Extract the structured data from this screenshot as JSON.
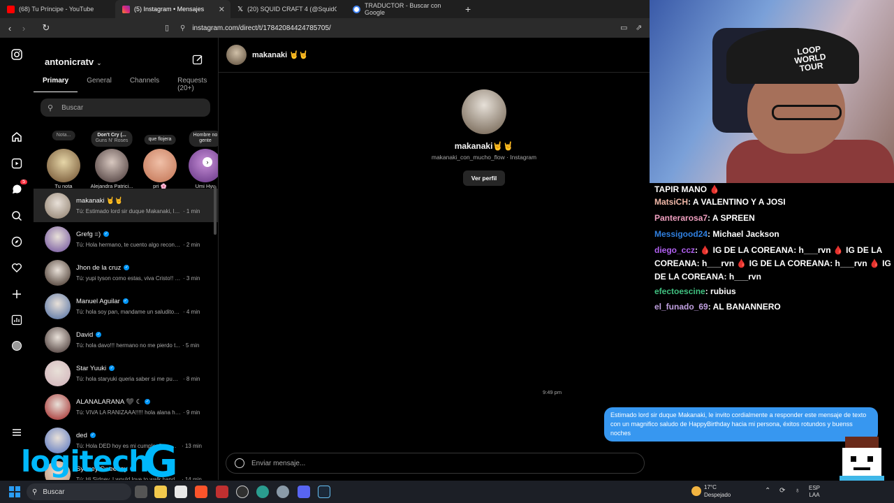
{
  "browser": {
    "tabs": [
      {
        "title": "(68) Tu Príncipe - YouTube",
        "color": "#ff0000"
      },
      {
        "title": "(5) Instagram • Mensajes",
        "color": "#e1306c",
        "active": true
      },
      {
        "title": "(20) SQUID CRAFT 4 (@SquidCraftGa",
        "color": "#000000"
      },
      {
        "title": "TRADUCTOR - Buscar con Google",
        "color": "#4285f4"
      }
    ],
    "new_tab": "+",
    "url": "instagram.com/direct/t/17842084424785705/"
  },
  "inbox": {
    "account": "antonicratv",
    "tabs": [
      "Primary",
      "General",
      "Channels",
      "Requests (20+)"
    ],
    "search_placeholder": "Buscar",
    "notes": [
      {
        "bubble": "Nota...",
        "name": "Tu nota",
        "color": "#d8c8a0"
      },
      {
        "bubble": "Don't Cry (...",
        "bubble2": "Guns N' Roses",
        "name": "Alejandra Patrici...",
        "color": "#c0b0a8"
      },
      {
        "bubble": "que flojera",
        "name": "pri 🌸",
        "color": "#e7a48c"
      },
      {
        "bubble": "Hombre no",
        "bubble2": "gente",
        "name": "Umi Hyu",
        "color": "#a070c0"
      }
    ],
    "threads": [
      {
        "name": "makanaki 🤘🤘",
        "preview": "Tú: Estimado lord sir duque Makanaki, le ...",
        "time": "· 1 min",
        "verified": false,
        "color": "#8a7a68"
      },
      {
        "name": "Grefg =)",
        "preview": "Tú: Hola hermano, te cuento algo recontr...",
        "time": "· 2 min",
        "verified": true,
        "color": "#6a4a9a"
      },
      {
        "name": "Jhon de la cruz",
        "preview": "Tú: yupi tyson como estas, viva Cristo!! h...",
        "time": "· 3 min",
        "verified": true,
        "color": "#3a2a20"
      },
      {
        "name": "Manuel Aguilar",
        "preview": "Tú: hola soy pan, mandame un saludito p...",
        "time": "· 4 min",
        "verified": true,
        "color": "#4a6aa0"
      },
      {
        "name": "David",
        "preview": "Tú: hola davo!!! hermano no me pierdo t...",
        "time": "· 5 min",
        "verified": true,
        "color": "#3a2a28"
      },
      {
        "name": "Star Yuuki",
        "preview": "Tú: hola staryuki queria saber si me pued...",
        "time": "· 8 min",
        "verified": true,
        "color": "#d0b0b8"
      },
      {
        "name": "ALANALARANA 🖤 ☾",
        "preview": "Tú: VIVA LA RANIZAAA!!!!! hola alana hoy...",
        "time": "· 9 min",
        "verified": true,
        "color": "#a02020"
      },
      {
        "name": "ded",
        "preview": "Tú: Hola DED hoy es mi cumpleaños, m...",
        "time": "· 13 min",
        "verified": true,
        "color": "#5070c0"
      },
      {
        "name": "Sydney Sweeney",
        "preview": "Tú: Hi Sidney, I would love to walk hand...",
        "time": "· 14 min",
        "verified": true,
        "color": "#c09070"
      }
    ]
  },
  "chat": {
    "header_name": "makanaki 🤘🤘",
    "profile_name": "makanaki🤘🤘",
    "profile_sub": "makanaki_con_mucho_flow · Instagram",
    "view_profile": "Ver perfil",
    "timestamp": "9:49 pm",
    "message": "Estimado lord sir duque Makanaki, le invito cordialmente a responder este mensaje de texto con un magnifico saludo de HappyBirthday hacia mi persona, éxitos rotundos y buenss noches",
    "composer_placeholder": "Enviar mensaje..."
  },
  "webcam": {
    "cap_text": "LOOP WORLD TOUR"
  },
  "stream_chat": [
    {
      "user": "",
      "text": "TAPIR MANO 🩸",
      "color": "#ffffff"
    },
    {
      "user": "MatsiCH",
      "text": ": A VALENTINO Y A JOSI",
      "color": "#f0b8a8"
    },
    {
      "user": "Panterarosa7",
      "text": ": A SPREEN",
      "color": "#f0a0c0"
    },
    {
      "user": "Messigood24",
      "text": ": Michael Jackson",
      "color": "#3080e0"
    },
    {
      "user": "diego_ccz",
      "text": ": 🩸 IG DE LA COREANA: h___rvn 🩸 IG DE LA COREANA: h___rvn 🩸 IG DE LA COREANA: h___rvn 🩸 IG DE LA COREANA: h___rvn",
      "color": "#b060f0"
    },
    {
      "user": "efectoescine",
      "text": ": rubius",
      "color": "#40c080"
    },
    {
      "user": "el_funado_69",
      "text": ": AL BANANNERO",
      "color": "#c0a0e0"
    }
  ],
  "overlay": {
    "brand": "logitech",
    "brand_g": "G"
  },
  "taskbar": {
    "search": "Buscar",
    "temp": "17°C",
    "weather": "Despejado",
    "lang1": "ESP",
    "lang2": "LAA"
  },
  "icons": {
    "rail": [
      "instagram-icon",
      "home-icon",
      "reels-icon",
      "messages-icon",
      "search-icon",
      "explore-icon",
      "heart-icon",
      "create-icon",
      "stats-icon",
      "profile-icon",
      "menu-icon"
    ],
    "rail_badge": "5"
  }
}
